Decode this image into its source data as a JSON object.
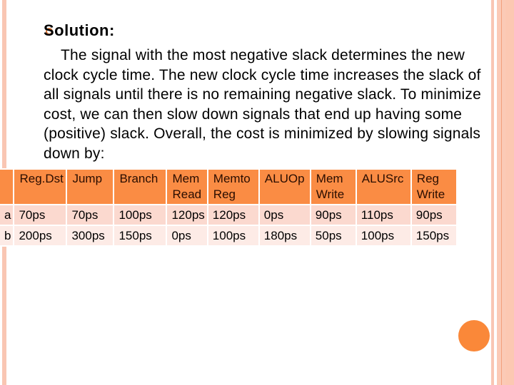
{
  "slide": {
    "heading": "Solution:",
    "paragraph": "The signal with the most negative slack determines the new clock cycle time. The new clock cycle time increases the slack of all signals until there is no remaining negative slack. To minimize cost, we can then slow down signals that end up having some (positive) slack. Overall, the cost is minimized by slowing signals down by:",
    "bullet_icon": "hollow-circle-bullet"
  },
  "table": {
    "headers": [
      "",
      "Reg.Dst",
      "Jump",
      "Branch",
      "Mem Read",
      "Memto Reg",
      "ALUOp",
      "Mem Write",
      "ALUSrc",
      "Reg Write"
    ],
    "rows": [
      {
        "label": "a",
        "values": [
          "70ps",
          "70ps",
          "100ps",
          "120ps",
          "120ps",
          "0ps",
          "90ps",
          "110ps",
          "90ps"
        ]
      },
      {
        "label": "b",
        "values": [
          "200ps",
          "300ps",
          "150ps",
          "0ps",
          "100ps",
          "180ps",
          "50ps",
          "100ps",
          "150ps"
        ]
      }
    ]
  },
  "colors": {
    "accent": "#fa8839",
    "header_bg": "#fa8c44",
    "row_a_bg": "#fbd9cf",
    "row_b_bg": "#fdebe6",
    "border_decor": "#f9c6b3"
  }
}
